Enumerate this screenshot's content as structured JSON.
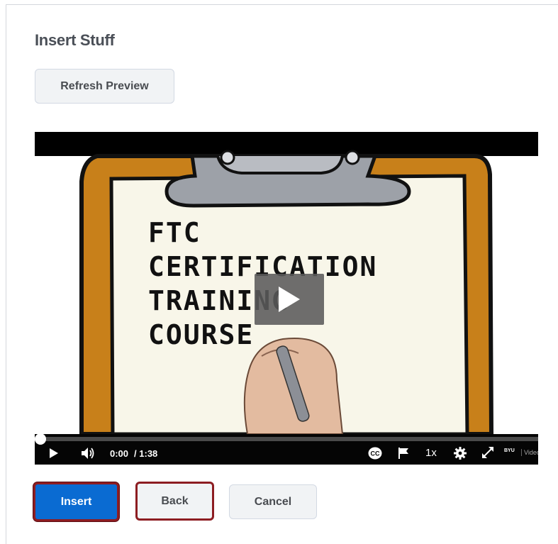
{
  "dialog": {
    "title": "Insert Stuff",
    "refresh_label": "Refresh Preview"
  },
  "video": {
    "thumbnail_text": [
      "FTC",
      "CERTIFICATION",
      "TRAINING",
      "COURSE"
    ],
    "progress_fraction": 0,
    "current_time": "0:00",
    "duration": "/ 1:38",
    "speed": "1x",
    "cc_label": "CC",
    "brand": "BYU",
    "brand_sub": "Video"
  },
  "footer": {
    "insert_label": "Insert",
    "back_label": "Back",
    "cancel_label": "Cancel"
  },
  "colors": {
    "primary": "#0a6bd2",
    "highlight_border": "#8d1d22",
    "clipboard_orange": "#c8801a",
    "paper": "#f8f6e9"
  }
}
